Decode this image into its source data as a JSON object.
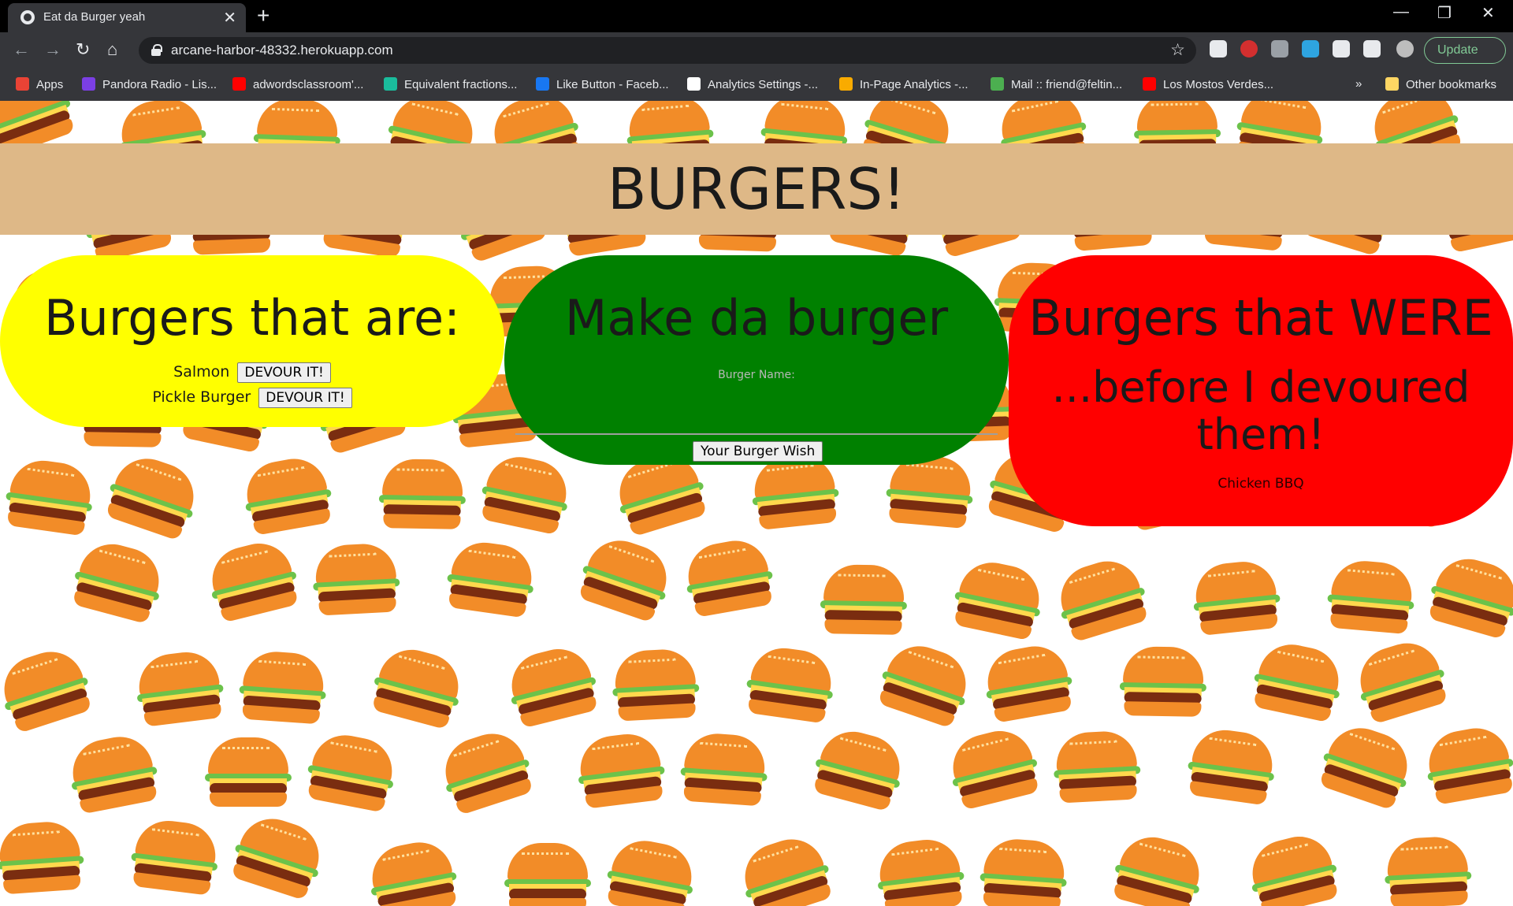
{
  "browser": {
    "tab_title": "Eat da Burger yeah",
    "url": "arcane-harbor-48332.herokuapp.com",
    "update_label": "Update",
    "bookmarks": [
      {
        "label": "Apps",
        "color": "#ea4335"
      },
      {
        "label": "Pandora Radio - Lis...",
        "color": "#7b3fe4"
      },
      {
        "label": "adwordsclassroom'...",
        "color": "#ff0000"
      },
      {
        "label": "Equivalent fractions...",
        "color": "#1abc9c"
      },
      {
        "label": "Like Button - Faceb...",
        "color": "#1877f2"
      },
      {
        "label": "Analytics Settings -...",
        "color": "#ffffff"
      },
      {
        "label": "In-Page Analytics -...",
        "color": "#f9ab00"
      },
      {
        "label": "Mail :: friend@feltin...",
        "color": "#4caf50"
      },
      {
        "label": "Los Mostos Verdes...",
        "color": "#ff0000"
      }
    ],
    "overflow_label": "»",
    "other_bookmarks": "Other bookmarks"
  },
  "page": {
    "title": "BURGERS!",
    "left": {
      "heading": "Burgers that are:",
      "items": [
        {
          "name": "Salmon",
          "button": "DEVOUR IT!"
        },
        {
          "name": "Pickle Burger",
          "button": "DEVOUR IT!"
        }
      ]
    },
    "middle": {
      "heading": "Make da burger",
      "field_label": "Burger Name:",
      "submit_label": "Your Burger Wish"
    },
    "right": {
      "heading": "Burgers that WERE",
      "subheading": "...before I devoured them!",
      "items": [
        "Chicken BBQ"
      ]
    },
    "colors": {
      "header_bg": "#deb887",
      "yellow": "#ffff00",
      "green": "#008000",
      "red": "#ff0000"
    }
  }
}
